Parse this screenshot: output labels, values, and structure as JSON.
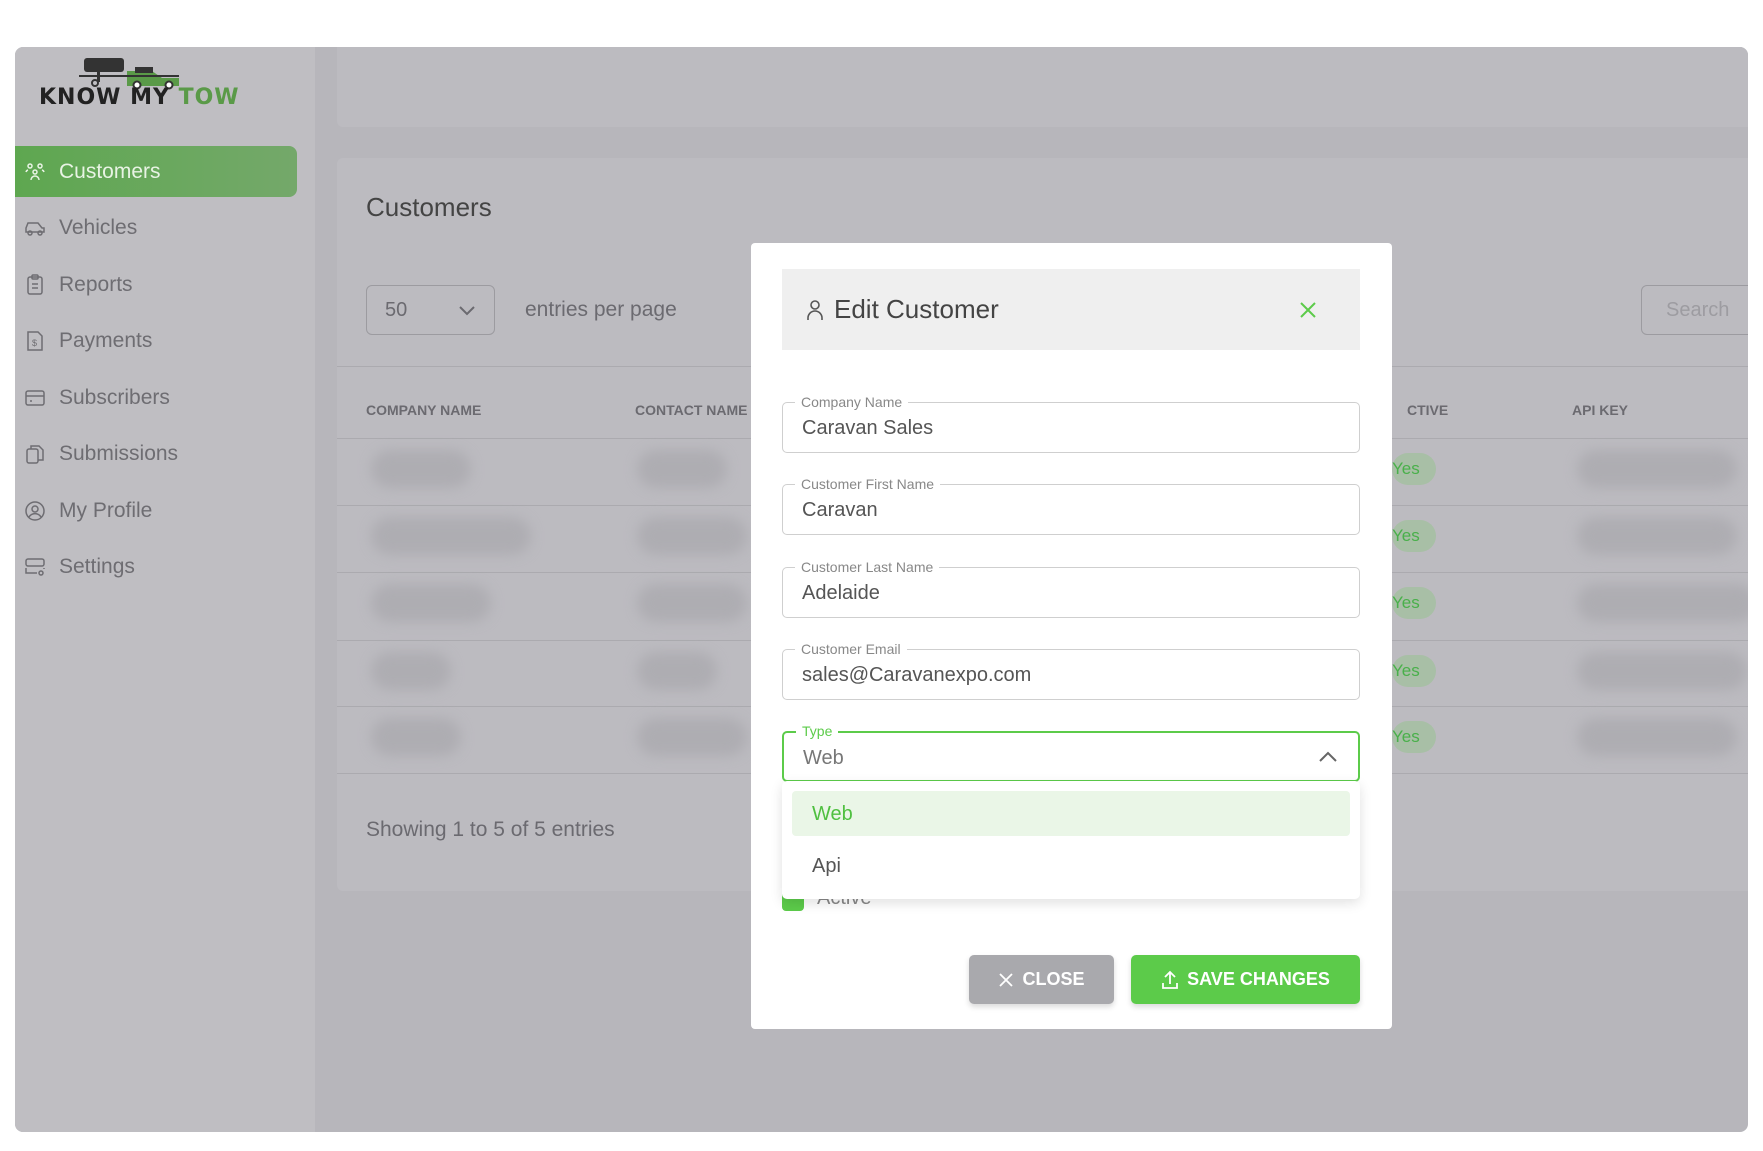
{
  "brand": {
    "logo_text_1": "KNOW MY",
    "logo_text_2": "TOW",
    "accent": "#5ccb4a"
  },
  "sidebar": {
    "items": [
      {
        "label": "Customers",
        "icon": "users-icon",
        "active": true
      },
      {
        "label": "Vehicles",
        "icon": "car-icon"
      },
      {
        "label": "Reports",
        "icon": "clipboard-icon"
      },
      {
        "label": "Payments",
        "icon": "invoice-dollar-icon"
      },
      {
        "label": "Subscribers",
        "icon": "card-icon"
      },
      {
        "label": "Submissions",
        "icon": "copy-icon"
      },
      {
        "label": "My Profile",
        "icon": "user-circle-icon"
      },
      {
        "label": "Settings",
        "icon": "server-gear-icon"
      }
    ]
  },
  "main": {
    "title": "Customers",
    "entries_value": "50",
    "entries_label": "entries per page",
    "search_placeholder": "Search",
    "columns": [
      "COMPANY NAME",
      "CONTACT NAME",
      "CTIVE",
      "API KEY"
    ],
    "rows": [
      {
        "active": "Yes"
      },
      {
        "active": "Yes"
      },
      {
        "active": "Yes"
      },
      {
        "active": "Yes"
      },
      {
        "active": "Yes"
      }
    ],
    "showing": "Showing 1 to 5 of 5 entries"
  },
  "modal": {
    "title": "Edit Customer",
    "fields": [
      {
        "label": "Company Name",
        "value": "Caravan Sales"
      },
      {
        "label": "Customer First Name",
        "value": "Caravan"
      },
      {
        "label": "Customer Last Name",
        "value": "Adelaide"
      },
      {
        "label": "Customer Email",
        "value": "sales@Caravanexpo.com"
      }
    ],
    "type": {
      "label": "Type",
      "value": "Web",
      "options": [
        "Web",
        "Api"
      ]
    },
    "active_label": "Active",
    "active_checked": true,
    "close_label": "CLOSE",
    "save_label": "SAVE CHANGES"
  }
}
